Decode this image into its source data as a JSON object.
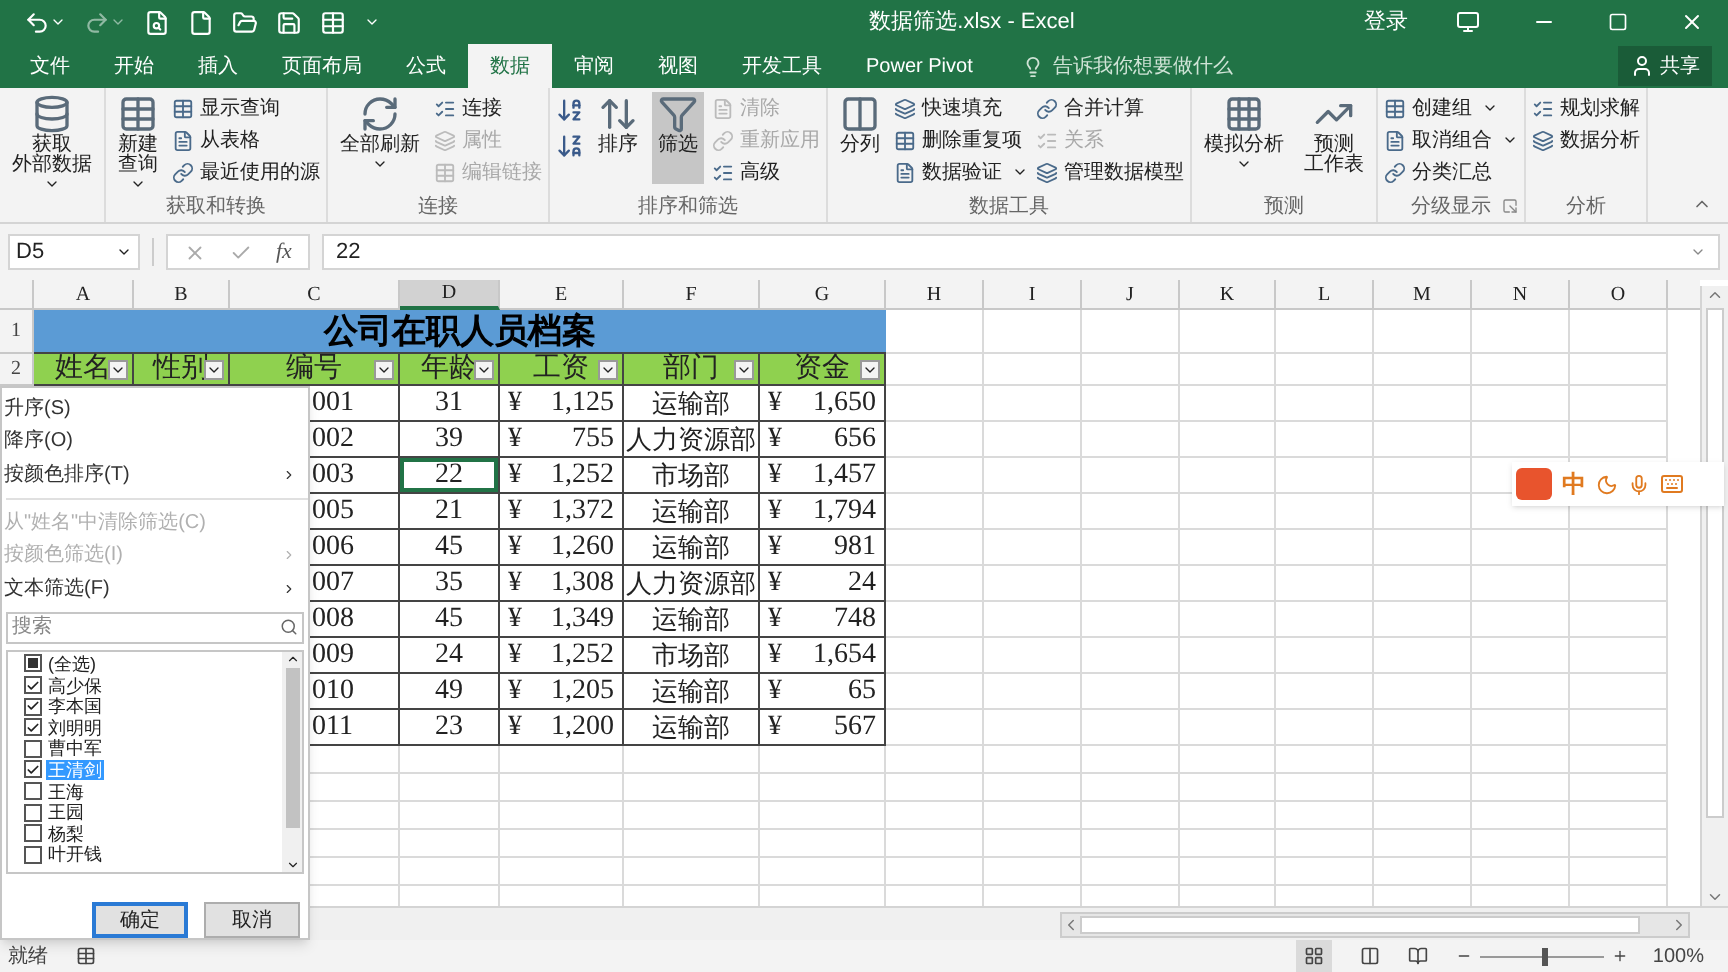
{
  "window": {
    "title": "数据筛选.xlsx - Excel",
    "sign_in": "登录"
  },
  "tabs": [
    {
      "label": "文件",
      "selected": false
    },
    {
      "label": "开始",
      "selected": false
    },
    {
      "label": "插入",
      "selected": false
    },
    {
      "label": "页面布局",
      "selected": false
    },
    {
      "label": "公式",
      "selected": false
    },
    {
      "label": "数据",
      "selected": true
    },
    {
      "label": "审阅",
      "selected": false
    },
    {
      "label": "视图",
      "selected": false
    },
    {
      "label": "开发工具",
      "selected": false
    },
    {
      "label": "Power Pivot",
      "selected": false
    }
  ],
  "tell_me": {
    "placeholder": "告诉我你想要做什么"
  },
  "share": "共享",
  "ribbon": {
    "groups": [
      {
        "items": [
          {
            "kind": "large",
            "lines": [
              "获取",
              "外部数据"
            ],
            "dropdown": true,
            "selected": false
          }
        ]
      },
      {
        "label": "获取和转换",
        "items": [
          {
            "kind": "large",
            "lines": [
              "新建",
              "查询"
            ],
            "dropdown": true,
            "selected": false
          },
          {
            "kind": "stack",
            "buttons": [
              {
                "label": "显示查询",
                "disabled": false,
                "dropdown": false
              },
              {
                "label": "从表格",
                "disabled": false,
                "dropdown": false
              },
              {
                "label": "最近使用的源",
                "disabled": false,
                "dropdown": false
              }
            ]
          }
        ]
      },
      {
        "label": "连接",
        "items": [
          {
            "kind": "large",
            "lines": [
              "全部刷新"
            ],
            "dropdown": true,
            "selected": false
          },
          {
            "kind": "stack",
            "buttons": [
              {
                "label": "连接",
                "disabled": false,
                "dropdown": false
              },
              {
                "label": "属性",
                "disabled": true,
                "dropdown": false
              },
              {
                "label": "编辑链接",
                "disabled": true,
                "dropdown": false
              }
            ]
          }
        ]
      },
      {
        "label": "排序和筛选",
        "items": [
          {
            "kind": "sort_icons"
          },
          {
            "kind": "large",
            "lines": [
              "排序"
            ],
            "dropdown": false,
            "selected": false
          },
          {
            "kind": "large",
            "lines": [
              "筛选"
            ],
            "dropdown": false,
            "selected": true
          },
          {
            "kind": "stack",
            "buttons": [
              {
                "label": "清除",
                "disabled": true,
                "dropdown": false
              },
              {
                "label": "重新应用",
                "disabled": true,
                "dropdown": false
              },
              {
                "label": "高级",
                "disabled": false,
                "dropdown": false
              }
            ]
          }
        ]
      },
      {
        "label": "数据工具",
        "items": [
          {
            "kind": "large",
            "lines": [
              "分列"
            ],
            "dropdown": false,
            "selected": false
          },
          {
            "kind": "stack",
            "buttons": [
              {
                "label": "快速填充",
                "disabled": false,
                "dropdown": false
              },
              {
                "label": "删除重复项",
                "disabled": false,
                "dropdown": false
              },
              {
                "label": "数据验证",
                "disabled": false,
                "dropdown": true
              }
            ]
          },
          {
            "kind": "stack",
            "buttons": [
              {
                "label": "合并计算",
                "disabled": false,
                "dropdown": false
              },
              {
                "label": "关系",
                "disabled": true,
                "dropdown": false
              },
              {
                "label": "管理数据模型",
                "disabled": false,
                "dropdown": false
              }
            ]
          }
        ]
      },
      {
        "label": "预测",
        "items": [
          {
            "kind": "large",
            "lines": [
              "模拟分析"
            ],
            "dropdown": true,
            "selected": false
          },
          {
            "kind": "large",
            "lines": [
              "预测",
              "工作表"
            ],
            "dropdown": false,
            "selected": false
          }
        ]
      },
      {
        "label": "分级显示",
        "launcher": true,
        "items": [
          {
            "kind": "stack",
            "buttons": [
              {
                "label": "创建组",
                "disabled": false,
                "dropdown": true
              },
              {
                "label": "取消组合",
                "disabled": false,
                "dropdown": true
              },
              {
                "label": "分类汇总",
                "disabled": false,
                "dropdown": false
              }
            ]
          }
        ]
      },
      {
        "label": "分析",
        "items": [
          {
            "kind": "stack",
            "buttons": [
              {
                "label": "规划求解",
                "disabled": false,
                "dropdown": false
              },
              {
                "label": "数据分析",
                "disabled": false,
                "dropdown": false
              }
            ]
          }
        ]
      }
    ]
  },
  "name_box": {
    "value": "D5"
  },
  "formula_bar": {
    "fx": "fx",
    "value": "22"
  },
  "sheet": {
    "columns": [
      {
        "label": "A",
        "selected": false
      },
      {
        "label": "B",
        "selected": false
      },
      {
        "label": "C",
        "selected": false
      },
      {
        "label": "D",
        "selected": true
      },
      {
        "label": "E",
        "selected": false
      },
      {
        "label": "F",
        "selected": false
      },
      {
        "label": "G",
        "selected": false
      },
      {
        "label": "H",
        "selected": false
      },
      {
        "label": "I",
        "selected": false
      },
      {
        "label": "J",
        "selected": false
      },
      {
        "label": "K",
        "selected": false
      },
      {
        "label": "L",
        "selected": false
      },
      {
        "label": "M",
        "selected": false
      },
      {
        "label": "N",
        "selected": false
      },
      {
        "label": "O",
        "selected": false
      }
    ],
    "row_numbers": [
      "1",
      "2"
    ],
    "title": "公司在职人员档案",
    "headers": [
      "姓名",
      "性别",
      "编号",
      "年龄",
      "工资",
      "部门",
      "资金"
    ],
    "rows": [
      {
        "id": "001",
        "age": {
          "text": "31",
          "selected": false
        },
        "salary": {
          "currency": "¥",
          "amount": "1,125"
        },
        "dept": "运输部",
        "fund": {
          "currency": "¥",
          "amount": "1,650"
        }
      },
      {
        "id": "002",
        "age": {
          "text": "39",
          "selected": false
        },
        "salary": {
          "currency": "¥",
          "amount": "755"
        },
        "dept": "人力资源部",
        "fund": {
          "currency": "¥",
          "amount": "656"
        }
      },
      {
        "id": "003",
        "age": {
          "text": "22",
          "selected": true
        },
        "salary": {
          "currency": "¥",
          "amount": "1,252"
        },
        "dept": "市场部",
        "fund": {
          "currency": "¥",
          "amount": "1,457"
        }
      },
      {
        "id": "005",
        "age": {
          "text": "21",
          "selected": false
        },
        "salary": {
          "currency": "¥",
          "amount": "1,372"
        },
        "dept": "运输部",
        "fund": {
          "currency": "¥",
          "amount": "1,794"
        }
      },
      {
        "id": "006",
        "age": {
          "text": "45",
          "selected": false
        },
        "salary": {
          "currency": "¥",
          "amount": "1,260"
        },
        "dept": "运输部",
        "fund": {
          "currency": "¥",
          "amount": "981"
        }
      },
      {
        "id": "007",
        "age": {
          "text": "35",
          "selected": false
        },
        "salary": {
          "currency": "¥",
          "amount": "1,308"
        },
        "dept": "人力资源部",
        "fund": {
          "currency": "¥",
          "amount": "24"
        }
      },
      {
        "id": "008",
        "age": {
          "text": "45",
          "selected": false
        },
        "salary": {
          "currency": "¥",
          "amount": "1,349"
        },
        "dept": "运输部",
        "fund": {
          "currency": "¥",
          "amount": "748"
        }
      },
      {
        "id": "009",
        "age": {
          "text": "24",
          "selected": false
        },
        "salary": {
          "currency": "¥",
          "amount": "1,252"
        },
        "dept": "市场部",
        "fund": {
          "currency": "¥",
          "amount": "1,654"
        }
      },
      {
        "id": "010",
        "age": {
          "text": "49",
          "selected": false
        },
        "salary": {
          "currency": "¥",
          "amount": "1,205"
        },
        "dept": "运输部",
        "fund": {
          "currency": "¥",
          "amount": "65"
        }
      },
      {
        "id": "011",
        "age": {
          "text": "23",
          "selected": false
        },
        "salary": {
          "currency": "¥",
          "amount": "1,200"
        },
        "dept": "运输部",
        "fund": {
          "currency": "¥",
          "amount": "567"
        }
      }
    ]
  },
  "filter_menu": {
    "items": [
      {
        "kind": "command",
        "label": "升序(S)",
        "disabled": false,
        "submenu": false
      },
      {
        "kind": "command",
        "label": "降序(O)",
        "disabled": false,
        "submenu": false
      },
      {
        "kind": "command",
        "label": "按颜色排序(T)",
        "disabled": false,
        "submenu": true
      },
      {
        "kind": "separator"
      },
      {
        "kind": "command",
        "label": "从\"姓名\"中清除筛选(C)",
        "disabled": true,
        "submenu": false
      },
      {
        "kind": "command",
        "label": "按颜色筛选(I)",
        "disabled": true,
        "submenu": true
      },
      {
        "kind": "command",
        "label": "文本筛选(F)",
        "disabled": false,
        "submenu": true
      }
    ],
    "search": {
      "placeholder": "搜索"
    },
    "list": [
      {
        "label": "(全选)",
        "checked": false,
        "indeterminate": true,
        "selected": false
      },
      {
        "label": "高少保",
        "checked": true,
        "indeterminate": false,
        "selected": false
      },
      {
        "label": "李本国",
        "checked": true,
        "indeterminate": false,
        "selected": false
      },
      {
        "label": "刘明明",
        "checked": true,
        "indeterminate": false,
        "selected": false
      },
      {
        "label": "曹中军",
        "checked": false,
        "indeterminate": false,
        "selected": false
      },
      {
        "label": "王清剑",
        "checked": true,
        "indeterminate": false,
        "selected": true
      },
      {
        "label": "王海",
        "checked": false,
        "indeterminate": false,
        "selected": false
      },
      {
        "label": "王园",
        "checked": false,
        "indeterminate": false,
        "selected": false
      },
      {
        "label": "杨梨",
        "checked": false,
        "indeterminate": false,
        "selected": false
      },
      {
        "label": "叶开钱",
        "checked": false,
        "indeterminate": false,
        "selected": false
      }
    ],
    "buttons": [
      {
        "label": "确定",
        "focused": true
      },
      {
        "label": "取消",
        "focused": false
      }
    ]
  },
  "ime_toolbar": {
    "mode": "中"
  },
  "status_bar": {
    "status": "就绪",
    "zoom": {
      "level": 0.5,
      "reading": "100%"
    }
  }
}
